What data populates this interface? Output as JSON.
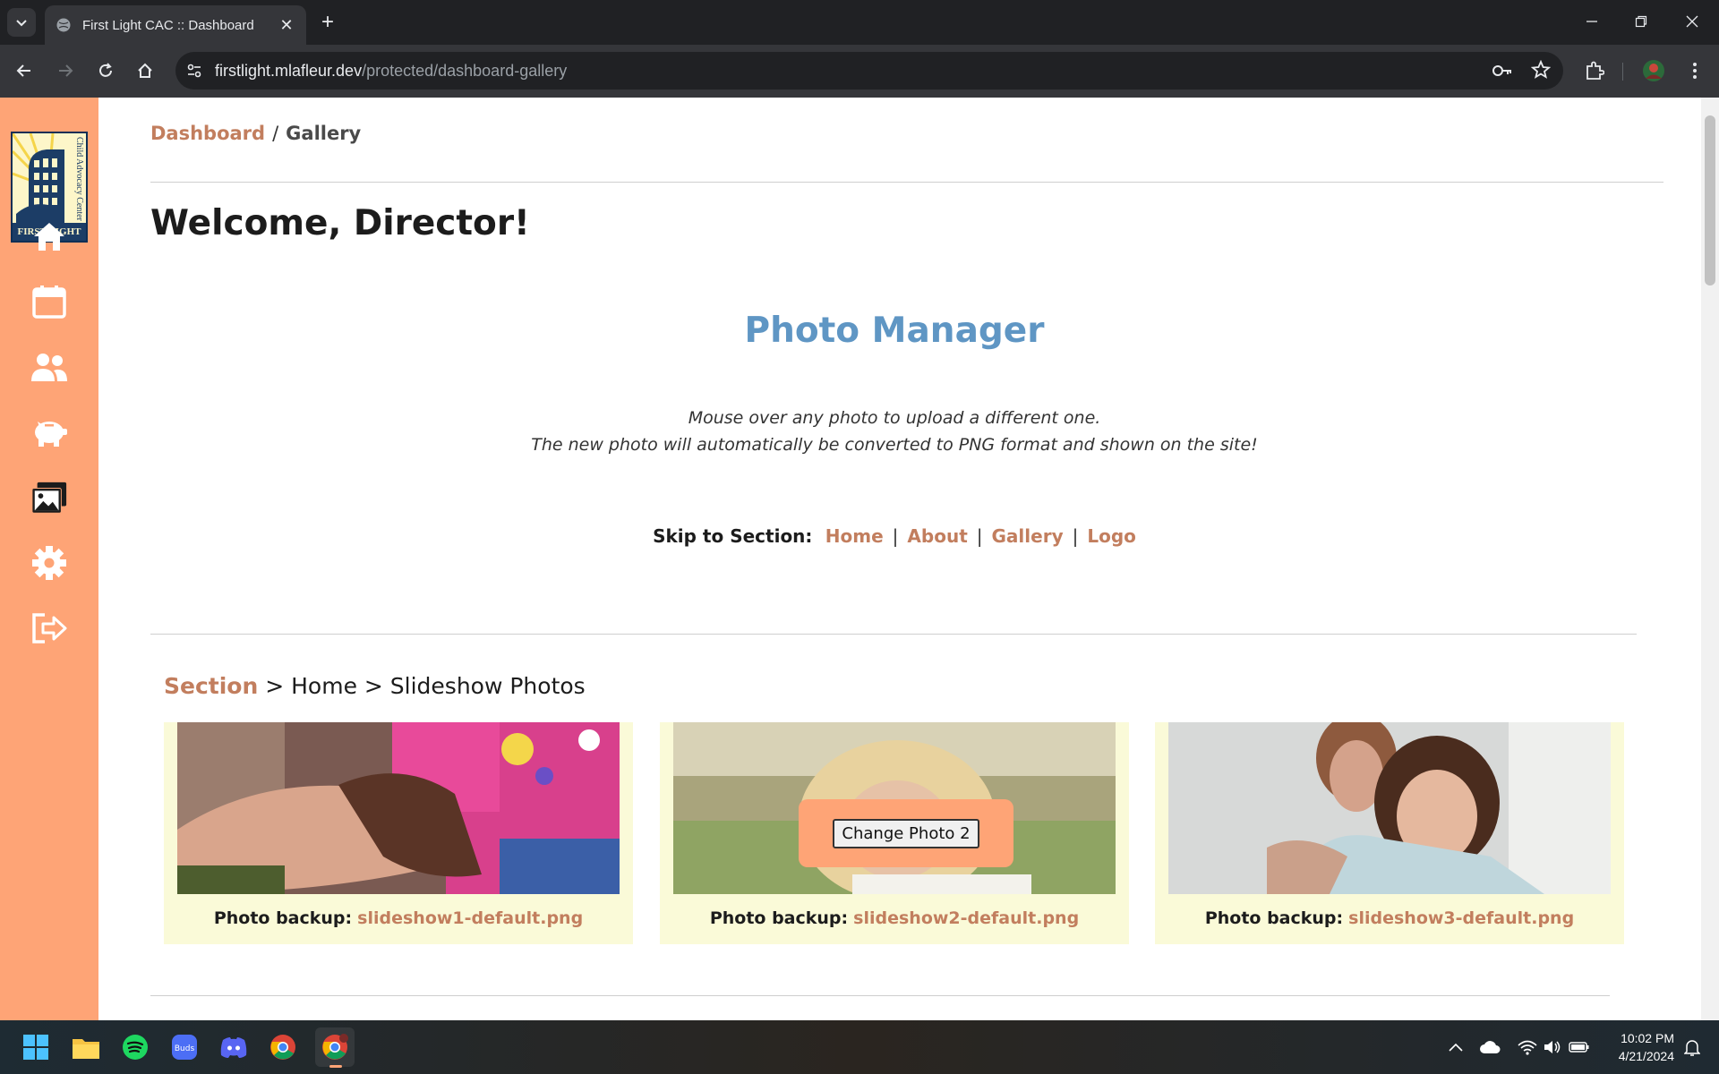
{
  "browser": {
    "tab_title": "First Light CAC :: Dashboard",
    "url_host": "firstlight.mlafleur.dev",
    "url_path": "/protected/dashboard-gallery"
  },
  "breadcrumb": {
    "dashboard": "Dashboard",
    "separator": "/",
    "current": "Gallery"
  },
  "welcome": "Welcome, Director!",
  "photo_manager": {
    "title": "Photo Manager",
    "instruction_1": "Mouse over any photo to upload a different one.",
    "instruction_2": "The new photo will automatically be converted to PNG format and shown on the site!"
  },
  "skip": {
    "label": "Skip to Section:",
    "links": [
      "Home",
      "About",
      "Gallery",
      "Logo"
    ],
    "divider": "|"
  },
  "section": {
    "label": "Section",
    "path": " > Home > Slideshow Photos"
  },
  "photos": [
    {
      "backup_label": "Photo backup:",
      "file": "slideshow1-default.png"
    },
    {
      "backup_label": "Photo backup:",
      "file": "slideshow2-default.png",
      "overlay_button": "Change Photo 2"
    },
    {
      "backup_label": "Photo backup:",
      "file": "slideshow3-default.png"
    }
  ],
  "logo_text": {
    "name": "FIRST LIGHT",
    "tagline": "Child Advocacy Center"
  },
  "sidebar_icons": [
    "home-icon",
    "calendar-icon",
    "users-icon",
    "piggy-bank-icon",
    "gallery-icon",
    "gear-icon",
    "logout-icon"
  ],
  "taskbar": {
    "time": "10:02 PM",
    "date": "4/21/2024"
  },
  "colors": {
    "sidebar": "#fea476",
    "accent_link": "#c27e5e",
    "title_blue": "#5f96c4",
    "card_bg": "#fafad8"
  }
}
